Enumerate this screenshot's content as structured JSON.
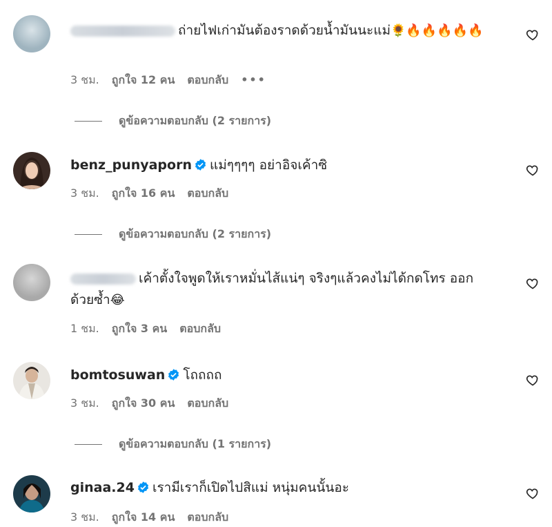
{
  "comments": [
    {
      "username": "",
      "verified": false,
      "text": "ถ่ายไฟเก่ามันต้องราดด้วยน้ำมันนะแม่",
      "emojis": "🌻🔥🔥🔥🔥🔥",
      "time": "3 ชม.",
      "likes": "ถูกใจ 12 คน",
      "reply": "ตอบกลับ",
      "more": "•••",
      "view_replies": "ดูข้อความตอบกลับ (2 รายการ)"
    },
    {
      "username": "benz_punyaporn",
      "verified": true,
      "text": "แม่ๆๆๆๆ อย่าอิจเค้าซิ",
      "time": "3 ชม.",
      "likes": "ถูกใจ 16 คน",
      "reply": "ตอบกลับ",
      "view_replies": "ดูข้อความตอบกลับ (2 รายการ)"
    },
    {
      "username": "",
      "verified": false,
      "text": "เค้าตั้งใจพูดให้เราหมั่นไส้แน่ๆ จริงๆแล้วคงไม่ได้กดโทร ออกด้วยซ้ำ",
      "emojis": "😂",
      "time": "1 ชม.",
      "likes": "ถูกใจ 3 คน",
      "reply": "ตอบกลับ"
    },
    {
      "username": "bomtosuwan",
      "verified": true,
      "text": "โถถถถ",
      "time": "3 ชม.",
      "likes": "ถูกใจ 30 คน",
      "reply": "ตอบกลับ",
      "view_replies": "ดูข้อความตอบกลับ (1 รายการ)"
    },
    {
      "username": "ginaa.24",
      "verified": true,
      "text": "เรามีเราก็เปิดไปสิแม่ หนุ่มคนนั้นอะ",
      "time": "3 ชม.",
      "likes": "ถูกใจ 14 คน",
      "reply": "ตอบกลับ"
    }
  ],
  "colors": {
    "verified": "#0095f6",
    "meta": "#737373",
    "text": "#262626"
  },
  "icons": {
    "like": "heart-outline-icon",
    "verified": "verified-badge-icon"
  }
}
